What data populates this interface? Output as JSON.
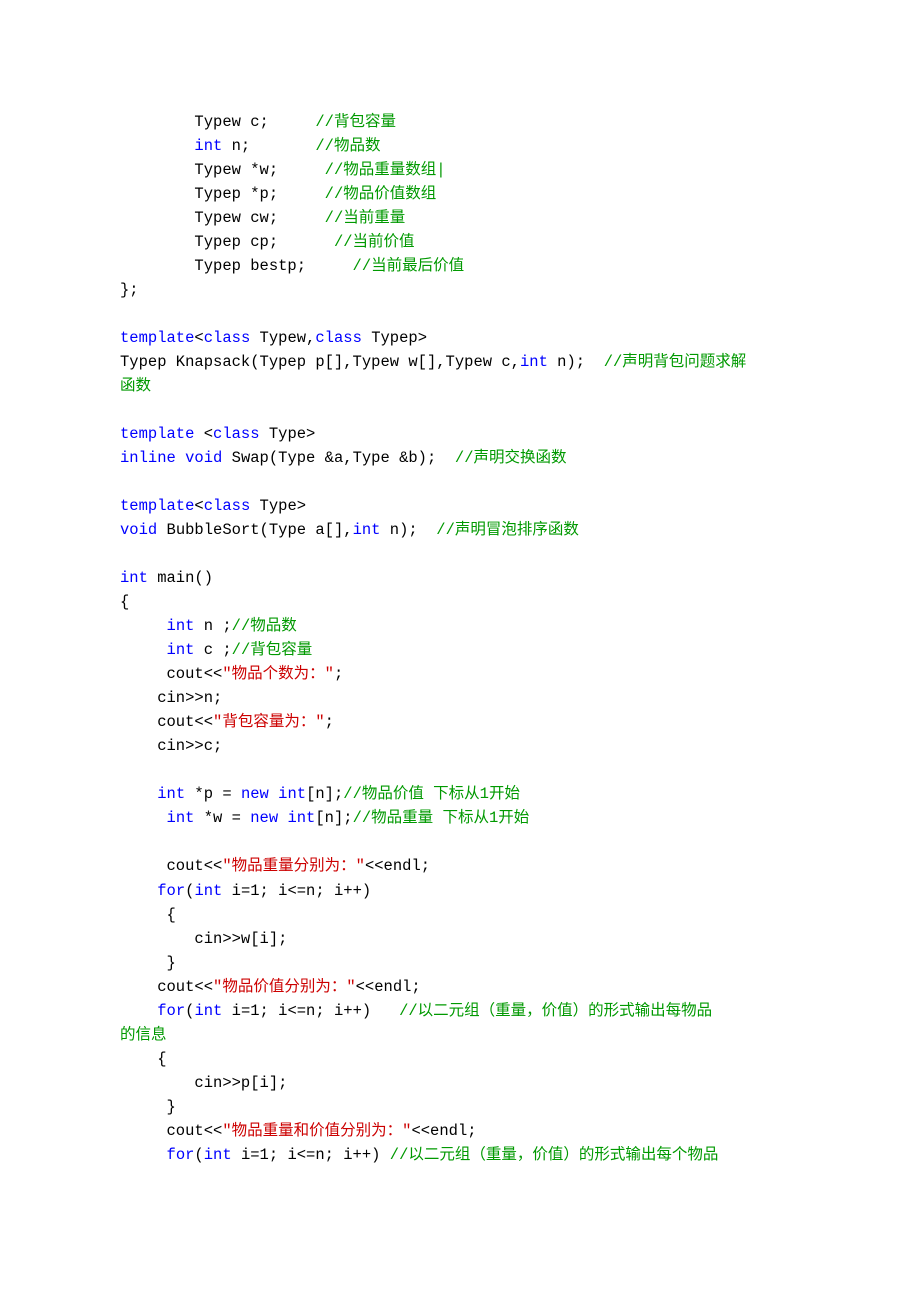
{
  "code": {
    "lines": [
      {
        "indent": "        ",
        "segs": [
          {
            "t": "Typew c;     ",
            "c": "plain"
          },
          {
            "t": "//背包容量",
            "c": "cm"
          }
        ]
      },
      {
        "indent": "        ",
        "segs": [
          {
            "t": "int",
            "c": "kw"
          },
          {
            "t": " n;       ",
            "c": "plain"
          },
          {
            "t": "//物品数",
            "c": "cm"
          }
        ]
      },
      {
        "indent": "        ",
        "segs": [
          {
            "t": "Typew *w;     ",
            "c": "plain"
          },
          {
            "t": "//物品重量数组|",
            "c": "cm"
          }
        ]
      },
      {
        "indent": "        ",
        "segs": [
          {
            "t": "Typep *p;     ",
            "c": "plain"
          },
          {
            "t": "//物品价值数组",
            "c": "cm"
          }
        ]
      },
      {
        "indent": "        ",
        "segs": [
          {
            "t": "Typew cw;     ",
            "c": "plain"
          },
          {
            "t": "//当前重量",
            "c": "cm"
          }
        ]
      },
      {
        "indent": "        ",
        "segs": [
          {
            "t": "Typep cp;      ",
            "c": "plain"
          },
          {
            "t": "//当前价值",
            "c": "cm"
          }
        ]
      },
      {
        "indent": "        ",
        "segs": [
          {
            "t": "Typep bestp;     ",
            "c": "plain"
          },
          {
            "t": "//当前最后价值",
            "c": "cm"
          }
        ]
      },
      {
        "indent": "",
        "segs": [
          {
            "t": "};",
            "c": "plain"
          }
        ]
      },
      {
        "indent": "",
        "segs": [
          {
            "t": "",
            "c": "plain"
          }
        ]
      },
      {
        "indent": "",
        "segs": [
          {
            "t": "template",
            "c": "kw"
          },
          {
            "t": "<",
            "c": "plain"
          },
          {
            "t": "class",
            "c": "kw"
          },
          {
            "t": " Typew,",
            "c": "plain"
          },
          {
            "t": "class",
            "c": "kw"
          },
          {
            "t": " Typep>",
            "c": "plain"
          }
        ]
      },
      {
        "indent": "",
        "segs": [
          {
            "t": "Typep Knapsack(Typep p[],Typew w[],Typew c,",
            "c": "plain"
          },
          {
            "t": "int",
            "c": "kw"
          },
          {
            "t": " n);  ",
            "c": "plain"
          },
          {
            "t": "//声明背包问题求解",
            "c": "cm"
          }
        ]
      },
      {
        "indent": "",
        "segs": [
          {
            "t": "函数",
            "c": "cm"
          }
        ]
      },
      {
        "indent": "",
        "segs": [
          {
            "t": "",
            "c": "plain"
          }
        ]
      },
      {
        "indent": "",
        "segs": [
          {
            "t": "template",
            "c": "kw"
          },
          {
            "t": " <",
            "c": "plain"
          },
          {
            "t": "class",
            "c": "kw"
          },
          {
            "t": " Type>",
            "c": "plain"
          }
        ]
      },
      {
        "indent": "",
        "segs": [
          {
            "t": "inline",
            "c": "kw"
          },
          {
            "t": " ",
            "c": "plain"
          },
          {
            "t": "void",
            "c": "kw"
          },
          {
            "t": " Swap(Type &a,Type &b);  ",
            "c": "plain"
          },
          {
            "t": "//声明交换函数",
            "c": "cm"
          }
        ]
      },
      {
        "indent": "",
        "segs": [
          {
            "t": "",
            "c": "plain"
          }
        ]
      },
      {
        "indent": "",
        "segs": [
          {
            "t": "template",
            "c": "kw"
          },
          {
            "t": "<",
            "c": "plain"
          },
          {
            "t": "class",
            "c": "kw"
          },
          {
            "t": " Type>",
            "c": "plain"
          }
        ]
      },
      {
        "indent": "",
        "segs": [
          {
            "t": "void",
            "c": "kw"
          },
          {
            "t": " BubbleSort(Type a[],",
            "c": "plain"
          },
          {
            "t": "int",
            "c": "kw"
          },
          {
            "t": " n);  ",
            "c": "plain"
          },
          {
            "t": "//声明冒泡排序函数",
            "c": "cm"
          }
        ]
      },
      {
        "indent": "",
        "segs": [
          {
            "t": "",
            "c": "plain"
          }
        ]
      },
      {
        "indent": "",
        "segs": [
          {
            "t": "int",
            "c": "kw"
          },
          {
            "t": " main()",
            "c": "plain"
          }
        ]
      },
      {
        "indent": "",
        "segs": [
          {
            "t": "{",
            "c": "plain"
          }
        ]
      },
      {
        "indent": "    ",
        "segs": [
          {
            "t": " ",
            "c": "plain"
          },
          {
            "t": "int",
            "c": "kw"
          },
          {
            "t": " n ;",
            "c": "plain"
          },
          {
            "t": "//物品数",
            "c": "cm"
          }
        ]
      },
      {
        "indent": "    ",
        "segs": [
          {
            "t": " ",
            "c": "plain"
          },
          {
            "t": "int",
            "c": "kw"
          },
          {
            "t": " c ;",
            "c": "plain"
          },
          {
            "t": "//背包容量",
            "c": "cm"
          }
        ]
      },
      {
        "indent": "    ",
        "segs": [
          {
            "t": " cout<<",
            "c": "plain"
          },
          {
            "t": "\"物品个数为：\"",
            "c": "str"
          },
          {
            "t": ";",
            "c": "plain"
          }
        ]
      },
      {
        "indent": "    ",
        "segs": [
          {
            "t": "cin>>n;",
            "c": "plain"
          }
        ]
      },
      {
        "indent": "    ",
        "segs": [
          {
            "t": "cout<<",
            "c": "plain"
          },
          {
            "t": "\"背包容量为：\"",
            "c": "str"
          },
          {
            "t": ";",
            "c": "plain"
          }
        ]
      },
      {
        "indent": "    ",
        "segs": [
          {
            "t": "cin>>c;",
            "c": "plain"
          }
        ]
      },
      {
        "indent": "",
        "segs": [
          {
            "t": "",
            "c": "plain"
          }
        ]
      },
      {
        "indent": "    ",
        "segs": [
          {
            "t": "int",
            "c": "kw"
          },
          {
            "t": " *p = ",
            "c": "plain"
          },
          {
            "t": "new",
            "c": "kw"
          },
          {
            "t": " ",
            "c": "plain"
          },
          {
            "t": "int",
            "c": "kw"
          },
          {
            "t": "[n];",
            "c": "plain"
          },
          {
            "t": "//物品价值 下标从1开始",
            "c": "cm"
          }
        ]
      },
      {
        "indent": "    ",
        "segs": [
          {
            "t": " ",
            "c": "plain"
          },
          {
            "t": "int",
            "c": "kw"
          },
          {
            "t": " *w = ",
            "c": "plain"
          },
          {
            "t": "new",
            "c": "kw"
          },
          {
            "t": " ",
            "c": "plain"
          },
          {
            "t": "int",
            "c": "kw"
          },
          {
            "t": "[n];",
            "c": "plain"
          },
          {
            "t": "//物品重量 下标从1开始",
            "c": "cm"
          }
        ]
      },
      {
        "indent": "",
        "segs": [
          {
            "t": "",
            "c": "plain"
          }
        ]
      },
      {
        "indent": "    ",
        "segs": [
          {
            "t": " cout<<",
            "c": "plain"
          },
          {
            "t": "\"物品重量分别为：\"",
            "c": "str"
          },
          {
            "t": "<<endl;",
            "c": "plain"
          }
        ]
      },
      {
        "indent": "    ",
        "segs": [
          {
            "t": "for",
            "c": "kw"
          },
          {
            "t": "(",
            "c": "plain"
          },
          {
            "t": "int",
            "c": "kw"
          },
          {
            "t": " i=1; i<=n; i++)",
            "c": "plain"
          }
        ]
      },
      {
        "indent": "    ",
        "segs": [
          {
            "t": " {",
            "c": "plain"
          }
        ]
      },
      {
        "indent": "        ",
        "segs": [
          {
            "t": "cin>>w[i];",
            "c": "plain"
          }
        ]
      },
      {
        "indent": "    ",
        "segs": [
          {
            "t": " }",
            "c": "plain"
          }
        ]
      },
      {
        "indent": "    ",
        "segs": [
          {
            "t": "cout<<",
            "c": "plain"
          },
          {
            "t": "\"物品价值分别为：\"",
            "c": "str"
          },
          {
            "t": "<<endl;",
            "c": "plain"
          }
        ]
      },
      {
        "indent": "    ",
        "segs": [
          {
            "t": "for",
            "c": "kw"
          },
          {
            "t": "(",
            "c": "plain"
          },
          {
            "t": "int",
            "c": "kw"
          },
          {
            "t": " i=1; i<=n; i++)   ",
            "c": "plain"
          },
          {
            "t": "//以二元组（重量，价值）的形式输出每物品",
            "c": "cm"
          }
        ]
      },
      {
        "indent": "",
        "segs": [
          {
            "t": "的信息",
            "c": "cm"
          }
        ]
      },
      {
        "indent": "    ",
        "segs": [
          {
            "t": "{",
            "c": "plain"
          }
        ]
      },
      {
        "indent": "        ",
        "segs": [
          {
            "t": "cin>>p[i];",
            "c": "plain"
          }
        ]
      },
      {
        "indent": "    ",
        "segs": [
          {
            "t": " }",
            "c": "plain"
          }
        ]
      },
      {
        "indent": "    ",
        "segs": [
          {
            "t": " cout<<",
            "c": "plain"
          },
          {
            "t": "\"物品重量和价值分别为：\"",
            "c": "str"
          },
          {
            "t": "<<endl;",
            "c": "plain"
          }
        ]
      },
      {
        "indent": "    ",
        "segs": [
          {
            "t": " ",
            "c": "plain"
          },
          {
            "t": "for",
            "c": "kw"
          },
          {
            "t": "(",
            "c": "plain"
          },
          {
            "t": "int",
            "c": "kw"
          },
          {
            "t": " i=1; i<=n; i++) ",
            "c": "plain"
          },
          {
            "t": "//以二元组（重量，价值）的形式输出每个物品",
            "c": "cm"
          }
        ]
      }
    ]
  }
}
